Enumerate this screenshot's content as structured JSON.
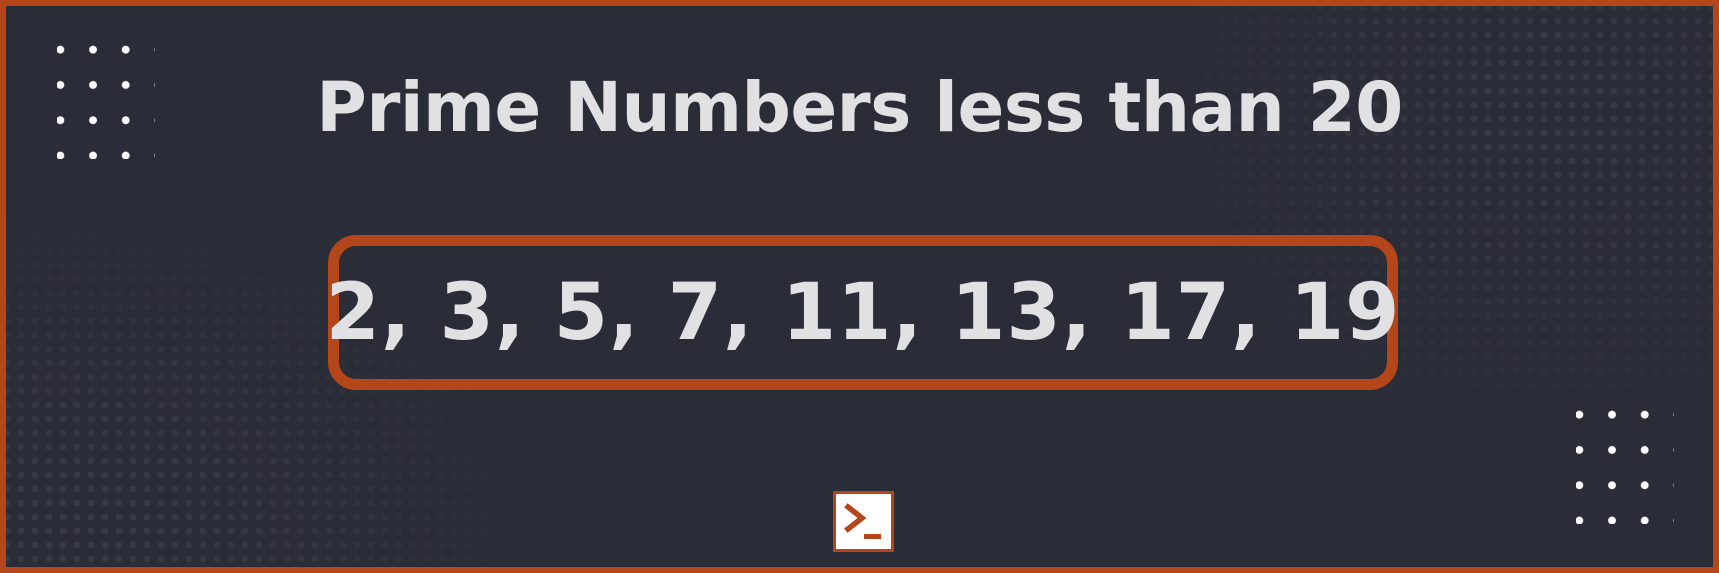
{
  "title": "Prime Numbers less than 20",
  "primes_text": "2, 3, 5, 7, 11, 13, 17, 19",
  "logo": {
    "icon": "terminal-prompt-icon"
  },
  "colors": {
    "background": "#2a2c38",
    "accent": "#b5461a",
    "text": "#e1e1e3",
    "dots": "#ffffff"
  }
}
